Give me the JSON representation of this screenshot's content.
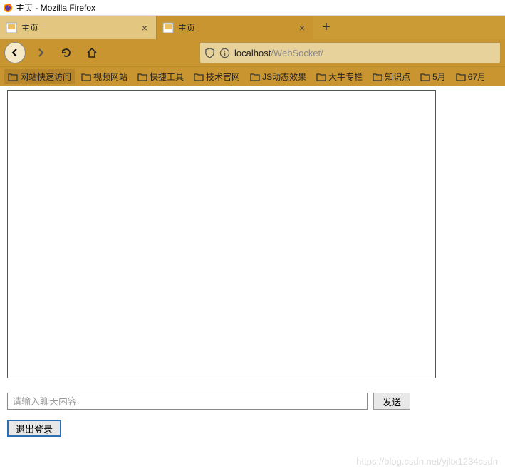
{
  "window": {
    "title": "主页 - Mozilla Firefox"
  },
  "tabs": [
    {
      "label": "主页",
      "active": false
    },
    {
      "label": "主页",
      "active": true
    }
  ],
  "url": {
    "host": "localhost",
    "path": "/WebSocket/"
  },
  "bookmarks": [
    {
      "label": "网站快速访问",
      "active": true
    },
    {
      "label": "视频网站"
    },
    {
      "label": "快捷工具"
    },
    {
      "label": "技术官网"
    },
    {
      "label": "JS动态效果"
    },
    {
      "label": "大牛专栏"
    },
    {
      "label": "知识点"
    },
    {
      "label": "5月"
    },
    {
      "label": "67月"
    }
  ],
  "chat": {
    "placeholder": "请输入聊天内容",
    "send_label": "发送",
    "logout_label": "退出登录"
  },
  "watermark": "https://blog.csdn.net/yjltx1234csdn"
}
